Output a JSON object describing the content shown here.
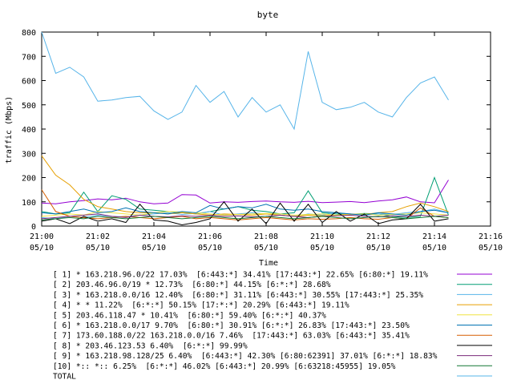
{
  "chart_data": {
    "type": "line",
    "title": "byte",
    "xlabel": "Time",
    "ylabel": "traffic (Mbps)",
    "ylim": [
      0,
      800
    ],
    "y_ticks": [
      0,
      100,
      200,
      300,
      400,
      500,
      600,
      700,
      800
    ],
    "x_range": [
      "21:00",
      "21:16"
    ],
    "x_ticks": [
      {
        "time": "21:00",
        "date": "05/10"
      },
      {
        "time": "21:02",
        "date": "05/10"
      },
      {
        "time": "21:04",
        "date": "05/10"
      },
      {
        "time": "21:06",
        "date": "05/10"
      },
      {
        "time": "21:08",
        "date": "05/10"
      },
      {
        "time": "21:10",
        "date": "05/10"
      },
      {
        "time": "21:12",
        "date": "05/10"
      },
      {
        "time": "21:14",
        "date": "05/10"
      },
      {
        "time": "21:16",
        "date": "05/10"
      }
    ],
    "grid": false,
    "legend_position": "bottom",
    "x": [
      "21:00",
      "21:00:30",
      "21:01",
      "21:01:30",
      "21:02",
      "21:02:30",
      "21:03",
      "21:03:30",
      "21:04",
      "21:04:30",
      "21:05",
      "21:05:30",
      "21:06",
      "21:06:30",
      "21:07",
      "21:07:30",
      "21:08",
      "21:08:30",
      "21:09",
      "21:09:30",
      "21:10",
      "21:10:30",
      "21:11",
      "21:11:30",
      "21:12",
      "21:12:30",
      "21:13",
      "21:13:30",
      "21:14",
      "21:14:30"
    ],
    "series": [
      {
        "name": "[ 1] * 163.218.96.0/22 17.03%  [6:443:*] 34.41% [17:443:*] 22.65% [6:80:*] 19.11%",
        "color": "#9400d3",
        "values": [
          95,
          92,
          100,
          105,
          112,
          108,
          115,
          100,
          92,
          95,
          130,
          128,
          95,
          100,
          98,
          101,
          103,
          100,
          98,
          102,
          97,
          99,
          101,
          97,
          103,
          108,
          120,
          100,
          96,
          190
        ]
      },
      {
        "name": "[ 2] 203.46.96.0/19 * 12.73%  [6:80:*] 44.15% [6:*:*] 28.68%",
        "color": "#009e73",
        "values": [
          60,
          50,
          55,
          140,
          60,
          125,
          110,
          70,
          65,
          60,
          55,
          50,
          60,
          70,
          80,
          65,
          60,
          50,
          55,
          145,
          55,
          50,
          48,
          52,
          50,
          40,
          35,
          40,
          200,
          45
        ]
      },
      {
        "name": "[ 3] * 163.218.0.0/16 12.40%  [6:80:*] 31.11% [6:443:*] 30.55% [17:443:*] 25.35%",
        "color": "#56b4e9",
        "values": [
          35,
          30,
          40,
          35,
          45,
          40,
          38,
          45,
          50,
          55,
          48,
          52,
          60,
          45,
          50,
          55,
          50,
          45,
          40,
          50,
          45,
          55,
          50,
          45,
          50,
          48,
          55,
          60,
          70,
          55
        ]
      },
      {
        "name": "[ 4] * * 11.22%  [6:*:*] 50.15% [17:*:*] 20.29% [6:443:*] 19.11%",
        "color": "#e69f00",
        "values": [
          290,
          210,
          170,
          110,
          80,
          70,
          60,
          55,
          55,
          50,
          55,
          50,
          45,
          50,
          48,
          45,
          50,
          45,
          40,
          45,
          42,
          45,
          50,
          48,
          55,
          60,
          80,
          95,
          80,
          60
        ]
      },
      {
        "name": "[ 5] 203.46.118.47 * 10.41%  [6:80:*] 59.40% [6:*:*] 40.37%",
        "color": "#f0e442",
        "values": [
          40,
          45,
          50,
          45,
          60,
          55,
          50,
          45,
          55,
          60,
          58,
          55,
          50,
          45,
          48,
          50,
          52,
          50,
          45,
          48,
          50,
          45,
          48,
          50,
          45,
          48,
          50,
          55,
          50,
          45
        ]
      },
      {
        "name": "[ 6] * 163.218.0.0/17 9.70%  [6:80:*] 30.91% [6:*:*] 26.83% [17:443:*] 23.50%",
        "color": "#0072b2",
        "values": [
          55,
          50,
          60,
          70,
          55,
          60,
          75,
          60,
          55,
          50,
          60,
          55,
          85,
          70,
          80,
          75,
          90,
          70,
          65,
          70,
          60,
          55,
          50,
          45,
          55,
          50,
          45,
          60,
          65,
          55
        ]
      },
      {
        "name": "[ 7] 173.60.188.0/22 163.218.0.0/16 7.46%  [17:443:*] 63.03% [6:443:*] 35.41%",
        "color": "#d55e00",
        "values": [
          150,
          60,
          40,
          35,
          30,
          35,
          40,
          35,
          30,
          35,
          40,
          30,
          35,
          30,
          25,
          30,
          35,
          30,
          25,
          30,
          28,
          30,
          35,
          30,
          28,
          35,
          30,
          75,
          40,
          35
        ]
      },
      {
        "name": "[ 8] * 203.46.123.53 6.40%  [6:*:*] 99.99%",
        "color": "#000000",
        "values": [
          20,
          30,
          10,
          40,
          20,
          30,
          15,
          90,
          25,
          20,
          5,
          15,
          30,
          100,
          20,
          70,
          10,
          95,
          20,
          90,
          15,
          60,
          20,
          50,
          10,
          25,
          30,
          90,
          20,
          30
        ]
      },
      {
        "name": "[ 9] * 163.218.98.128/25 6.40%  [6:443:*] 42.30% [6:80:62391] 37.01% [6:*:*] 18.83%",
        "color": "#7a2a7a",
        "values": [
          30,
          35,
          40,
          45,
          50,
          40,
          35,
          45,
          40,
          38,
          42,
          40,
          45,
          40,
          42,
          38,
          40,
          45,
          40,
          35,
          40,
          42,
          45,
          40,
          38,
          42,
          40,
          45,
          40,
          45
        ]
      },
      {
        "name": "[10] *:: *:: 6.25%  [6:*:*] 46.02% [6:443:*] 20.99% [6:63218:45955] 19.05%",
        "color": "#117733",
        "values": [
          25,
          30,
          35,
          30,
          40,
          35,
          30,
          35,
          40,
          35,
          30,
          35,
          40,
          35,
          30,
          35,
          40,
          35,
          30,
          35,
          40,
          35,
          30,
          35,
          40,
          35,
          30,
          35,
          40,
          35
        ]
      },
      {
        "name": "TOTAL",
        "color": "#56b4e9",
        "values": [
          800,
          630,
          655,
          615,
          515,
          520,
          530,
          535,
          475,
          440,
          470,
          580,
          510,
          555,
          450,
          530,
          470,
          500,
          400,
          720,
          510,
          480,
          490,
          510,
          470,
          450,
          530,
          590,
          615,
          520
        ]
      }
    ]
  }
}
